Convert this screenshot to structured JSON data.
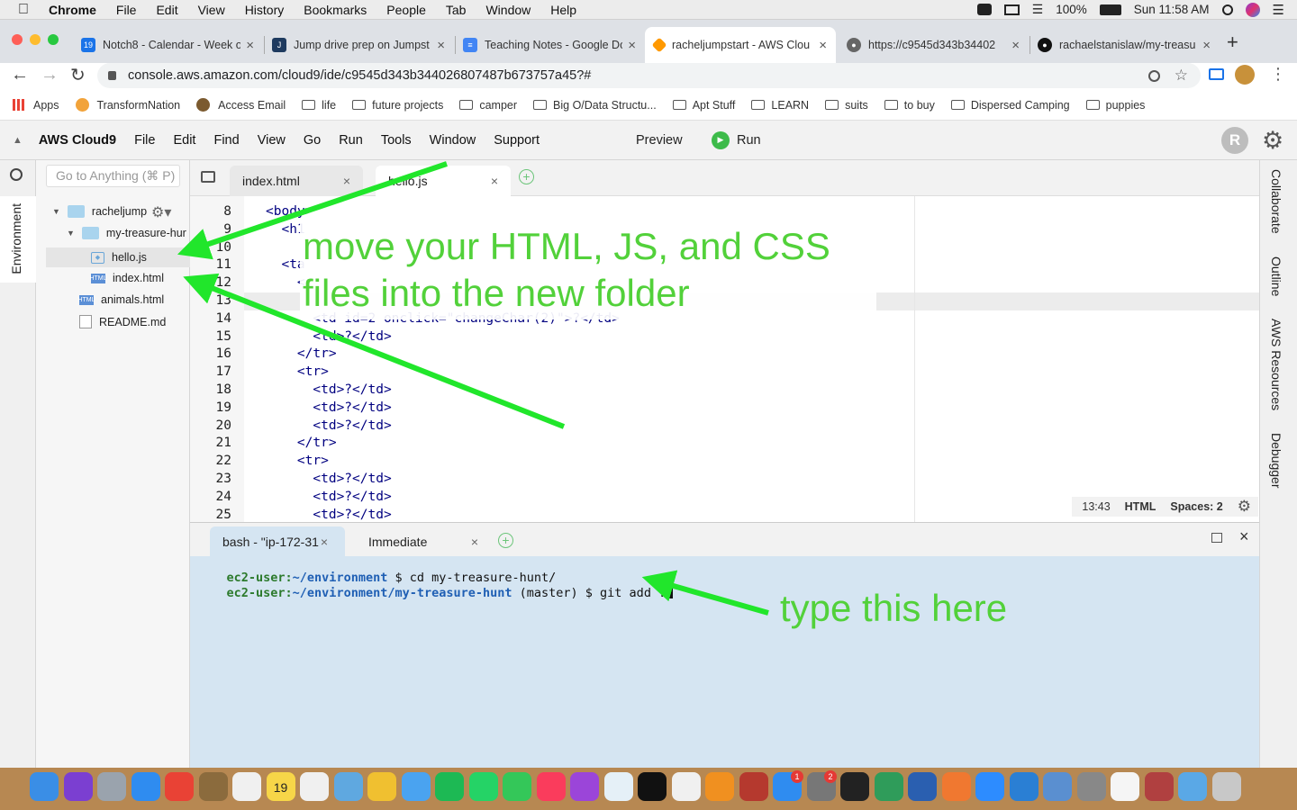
{
  "menubar": {
    "app": "Chrome",
    "items": [
      "File",
      "Edit",
      "View",
      "History",
      "Bookmarks",
      "People",
      "Tab",
      "Window",
      "Help"
    ],
    "battery": "100%",
    "clock": "Sun 11:58 AM"
  },
  "tabs": [
    {
      "title": "Notch8 - Calendar - Week o",
      "color": "#1a73e8"
    },
    {
      "title": "Jump drive prep on Jumpst",
      "color": "#1e3a5f"
    },
    {
      "title": "Teaching Notes - Google Do",
      "color": "#4285f4"
    },
    {
      "title": "racheljumpstart - AWS Clou",
      "color": "#ff9900"
    },
    {
      "title": "https://c9545d343b34402",
      "color": "#555555"
    },
    {
      "title": "rachaelstanislaw/my-treasu",
      "color": "#111111"
    }
  ],
  "address": "console.aws.amazon.com/cloud9/ide/c9545d343b344026807487b673757a45?#",
  "bookmarks": [
    "Apps",
    "TransformNation",
    "Access Email",
    "life",
    "future projects",
    "camper",
    "Big O/Data Structu...",
    "Apt Stuff",
    "LEARN",
    "suits",
    "to buy",
    "Dispersed Camping",
    "puppies"
  ],
  "cloud9": {
    "brand": "AWS Cloud9",
    "menu": [
      "File",
      "Edit",
      "Find",
      "View",
      "Go",
      "Run",
      "Tools",
      "Window",
      "Support"
    ],
    "preview": "Preview",
    "run": "Run",
    "avatar": "R",
    "search_placeholder": "Go to Anything (⌘ P)",
    "left_rail_label": "Environment",
    "right_rail": [
      "Collaborate",
      "Outline",
      "AWS Resources",
      "Debugger"
    ]
  },
  "tree": {
    "root": "racheljump",
    "folder": "my-treasure-hur",
    "files_in_folder": [
      "hello.js",
      "index.html"
    ],
    "root_files": [
      "animals.html",
      "README.md"
    ]
  },
  "editor": {
    "tabs": [
      "index.html",
      "hello.js"
    ],
    "lines": [
      {
        "n": "8",
        "code": "<body>"
      },
      {
        "n": "9",
        "code": "  <h1"
      },
      {
        "n": "10",
        "code": ""
      },
      {
        "n": "11",
        "code": "  <ta"
      },
      {
        "n": "12",
        "code": "    <"
      },
      {
        "n": "13",
        "code": ""
      },
      {
        "n": "14",
        "code": "      <td id=2 onclick=\"changeChar(2)\">?</td>"
      },
      {
        "n": "15",
        "code": "      <td>?</td>"
      },
      {
        "n": "16",
        "code": "    </tr>"
      },
      {
        "n": "17",
        "code": "    <tr>"
      },
      {
        "n": "18",
        "code": "      <td>?</td>"
      },
      {
        "n": "19",
        "code": "      <td>?</td>"
      },
      {
        "n": "20",
        "code": "      <td>?</td>"
      },
      {
        "n": "21",
        "code": "    </tr>"
      },
      {
        "n": "22",
        "code": "    <tr>"
      },
      {
        "n": "23",
        "code": "      <td>?</td>"
      },
      {
        "n": "24",
        "code": "      <td>?</td>"
      },
      {
        "n": "25",
        "code": "      <td>?</td>"
      }
    ],
    "status": {
      "pos": "13:43",
      "lang": "HTML",
      "spaces": "Spaces: 2"
    }
  },
  "terminal": {
    "tabs": [
      "bash - \"ip-172-31",
      "Immediate"
    ],
    "lines": [
      {
        "user": "ec2-user:",
        "path": "~/environment",
        "rest": " $ cd my-treasure-hunt/"
      },
      {
        "user": "ec2-user:",
        "path": "~/environment/my-treasure-hunt",
        "rest": " (master) $ git add ."
      }
    ]
  },
  "annotations": {
    "note1_line1": "move your HTML, JS, and CSS",
    "note1_line2": "files into the new folder",
    "note2": "type this here",
    "arrow_color": "#21e62b"
  },
  "dock": {
    "calendar_day": "19",
    "notif_a": "1",
    "notif_b": "2"
  }
}
